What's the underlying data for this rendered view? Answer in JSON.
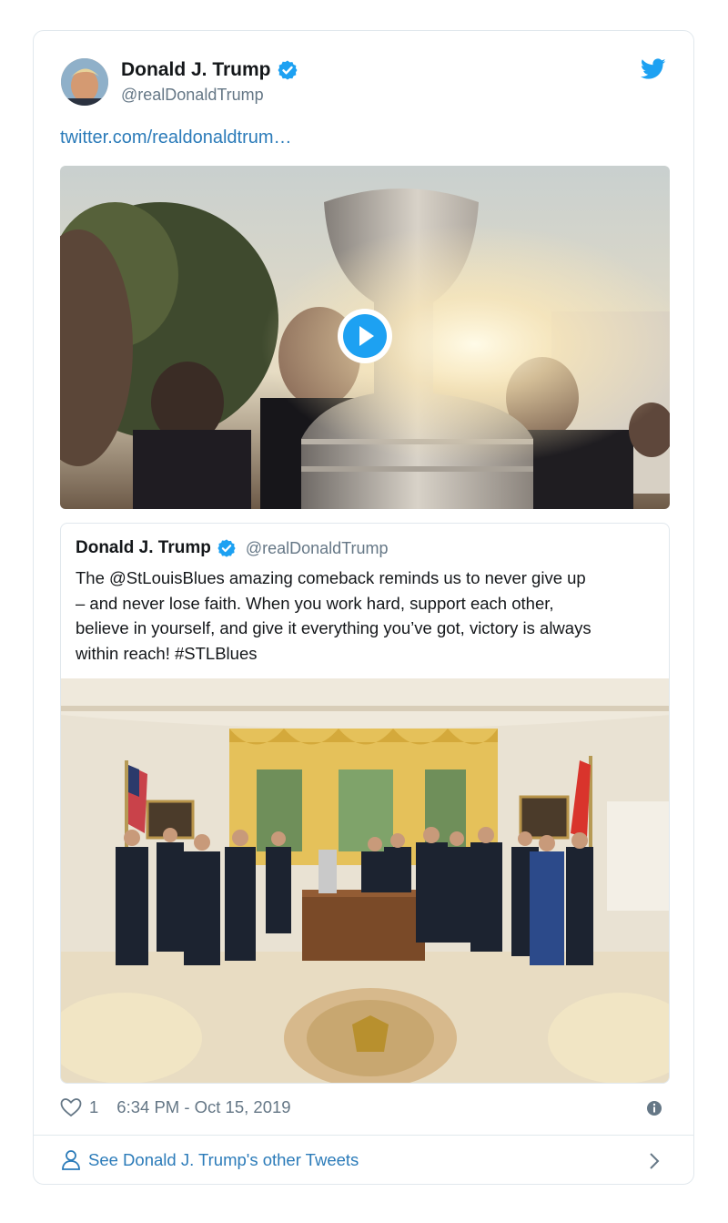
{
  "tweet": {
    "author_name": "Donald J. Trump",
    "author_handle": "@realDonaldTrump",
    "link_text": "twitter.com/realdonaldtrum…",
    "likes": "1",
    "timestamp": "6:34 PM - Oct 15, 2019"
  },
  "quoted": {
    "author_name": "Donald J. Trump",
    "author_handle": "@realDonaldTrump",
    "text": "The @StLouisBlues amazing comeback reminds us to never give up\n– and never lose faith. When you work hard, support each other,\nbelieve in yourself, and give it everything you’ve got, victory is always\nwithin reach! #STLBlues"
  },
  "footer": {
    "label": "See Donald J. Trump's other Tweets"
  },
  "icons": {
    "brand": "twitter-bird-icon",
    "verified": "verified-badge-icon",
    "play": "play-icon",
    "like": "heart-icon",
    "info": "info-icon",
    "person": "person-icon",
    "chevron": "chevron-right-icon"
  },
  "colors": {
    "link": "#2b7bb9",
    "twitter_blue": "#1da1f2",
    "muted": "#657786",
    "border": "#e1e8ed"
  }
}
